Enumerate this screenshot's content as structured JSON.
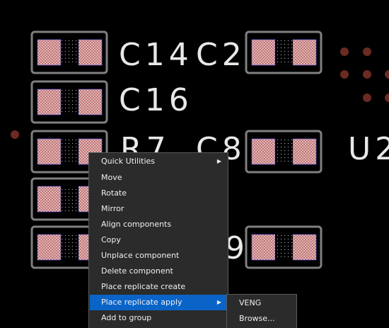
{
  "canvas": {
    "background": "#000000",
    "outline_color": "#808080",
    "pad_color": "#c96464",
    "center_color": "#000000",
    "via_color": "#6b2a22",
    "silk_color": "#e8e8e8",
    "labels": [
      "C14",
      "C2",
      "C16",
      "R7",
      "C8",
      "U2",
      "9"
    ]
  },
  "context_menu": {
    "highlight_color": "#0a64c8",
    "items": [
      {
        "label": "Quick Utilities",
        "submenu": true
      },
      {
        "label": "Move"
      },
      {
        "label": "Rotate"
      },
      {
        "label": "Mirror"
      },
      {
        "label": "Align components"
      },
      {
        "label": "Copy"
      },
      {
        "label": "Unplace component"
      },
      {
        "label": "Delete component"
      },
      {
        "label": "Place replicate create"
      },
      {
        "label": "Place replicate apply",
        "submenu": true,
        "highlighted": true
      },
      {
        "label": "Add to group"
      }
    ],
    "submenu_icon": "chevron-right-icon"
  },
  "submenu": {
    "items": [
      {
        "label": "VENG"
      },
      {
        "label": "Browse..."
      }
    ]
  }
}
